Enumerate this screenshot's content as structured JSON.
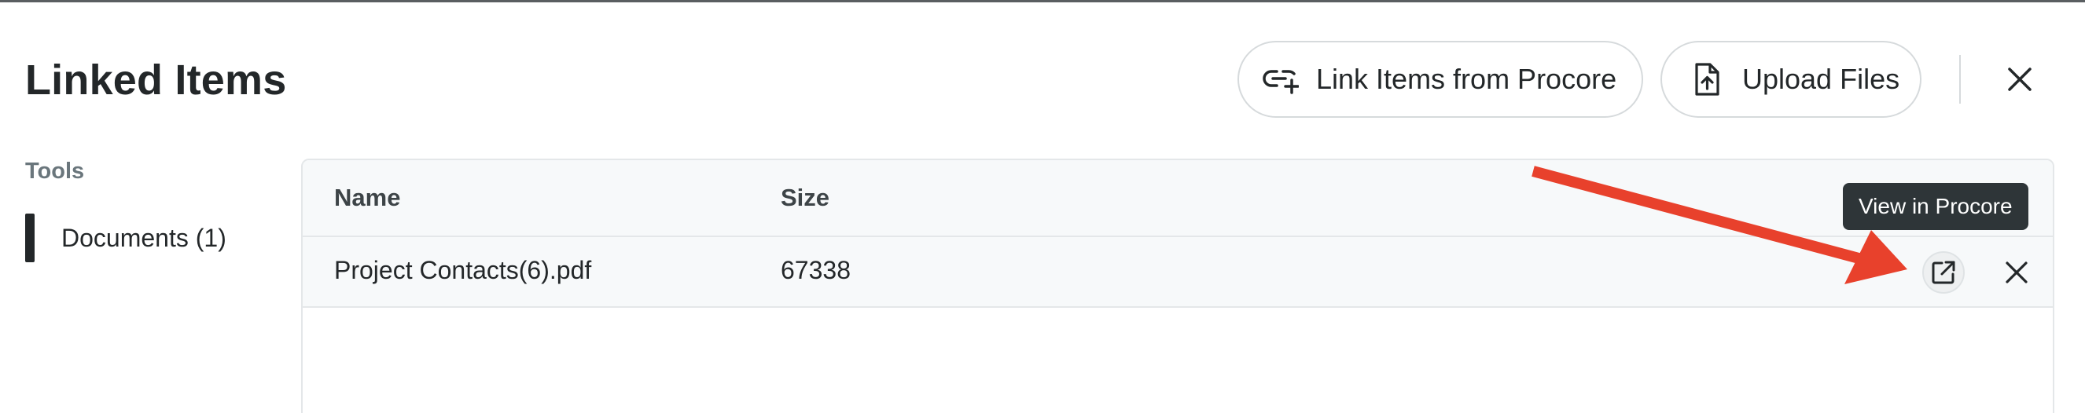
{
  "modal": {
    "title": "Linked Items",
    "close_icon": "close-icon"
  },
  "header": {
    "link_button_label": "Link Items from Procore",
    "link_icon": "link-plus-icon",
    "upload_button_label": "Upload Files",
    "upload_icon": "file-upload-icon"
  },
  "sidebar": {
    "heading": "Tools",
    "items": [
      {
        "label": "Documents (1)",
        "selected": true
      }
    ]
  },
  "table": {
    "columns": [
      "Name",
      "Size"
    ],
    "rows": [
      {
        "name": "Project Contacts(6).pdf",
        "size": "67338"
      }
    ],
    "row_actions": {
      "view_icon": "open-external-icon",
      "remove_icon": "close-icon"
    }
  },
  "tooltip": {
    "text": "View in Procore"
  },
  "annotation": {
    "arrow_color": "#e8412c"
  },
  "colors": {
    "text_primary": "#232729",
    "muted": "#6a767c",
    "border": "#d6dadc",
    "tooltip_bg": "#2e3538"
  }
}
